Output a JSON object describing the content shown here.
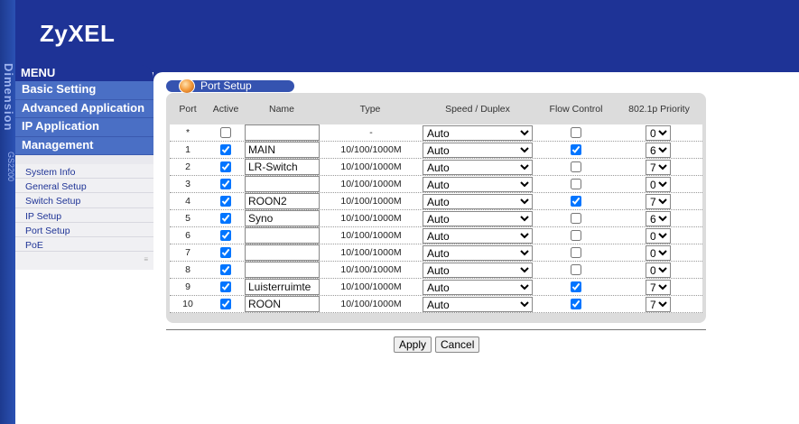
{
  "brand": {
    "logo": "ZyXEL",
    "vertical_brand": "Dimension",
    "vertical_model": "GS2200"
  },
  "menu": {
    "title": "MENU",
    "main_items": [
      "Basic Setting",
      "Advanced Application",
      "IP Application",
      "Management"
    ],
    "sub_items": [
      "System Info",
      "General Setup",
      "Switch Setup",
      "IP Setup",
      "Port Setup",
      "PoE"
    ],
    "sub_footer": "≡"
  },
  "section": {
    "title": "Port Setup"
  },
  "table": {
    "headers": [
      "Port",
      "Active",
      "Name",
      "Type",
      "Speed / Duplex",
      "Flow Control",
      "802.1p Priority"
    ],
    "rows": [
      {
        "port": "*",
        "active": false,
        "name": "",
        "type": "-",
        "speed": "Auto",
        "flow": false,
        "priority": "0"
      },
      {
        "port": "1",
        "active": true,
        "name": "MAIN",
        "type": "10/100/1000M",
        "speed": "Auto",
        "flow": true,
        "priority": "6"
      },
      {
        "port": "2",
        "active": true,
        "name": "LR-Switch",
        "type": "10/100/1000M",
        "speed": "Auto",
        "flow": false,
        "priority": "7"
      },
      {
        "port": "3",
        "active": true,
        "name": "",
        "type": "10/100/1000M",
        "speed": "Auto",
        "flow": false,
        "priority": "0"
      },
      {
        "port": "4",
        "active": true,
        "name": "ROON2",
        "type": "10/100/1000M",
        "speed": "Auto",
        "flow": true,
        "priority": "7"
      },
      {
        "port": "5",
        "active": true,
        "name": "Syno",
        "type": "10/100/1000M",
        "speed": "Auto",
        "flow": false,
        "priority": "6"
      },
      {
        "port": "6",
        "active": true,
        "name": "",
        "type": "10/100/1000M",
        "speed": "Auto",
        "flow": false,
        "priority": "0"
      },
      {
        "port": "7",
        "active": true,
        "name": "",
        "type": "10/100/1000M",
        "speed": "Auto",
        "flow": false,
        "priority": "0"
      },
      {
        "port": "8",
        "active": true,
        "name": "",
        "type": "10/100/1000M",
        "speed": "Auto",
        "flow": false,
        "priority": "0"
      },
      {
        "port": "9",
        "active": true,
        "name": "Luisterruimte",
        "type": "10/100/1000M",
        "speed": "Auto",
        "flow": true,
        "priority": "7"
      },
      {
        "port": "10",
        "active": true,
        "name": "ROON",
        "type": "10/100/1000M",
        "speed": "Auto",
        "flow": true,
        "priority": "7"
      }
    ]
  },
  "buttons": {
    "apply": "Apply",
    "cancel": "Cancel"
  },
  "colors": {
    "header": "#1e3396",
    "menu_item": "#4a6fc5",
    "accent_orb": "#f39a3a"
  }
}
